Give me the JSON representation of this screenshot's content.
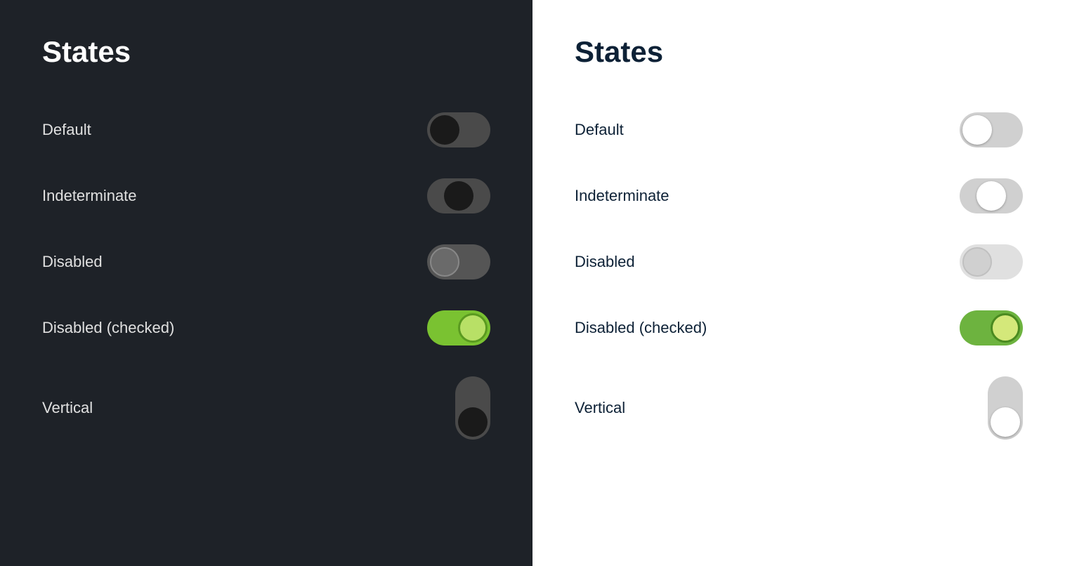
{
  "dark_panel": {
    "title": "States",
    "rows": [
      {
        "id": "default",
        "label": "Default"
      },
      {
        "id": "indeterminate",
        "label": "Indeterminate"
      },
      {
        "id": "disabled",
        "label": "Disabled"
      },
      {
        "id": "disabled-checked",
        "label": "Disabled (checked)"
      },
      {
        "id": "vertical",
        "label": "Vertical"
      }
    ]
  },
  "light_panel": {
    "title": "States",
    "rows": [
      {
        "id": "default",
        "label": "Default"
      },
      {
        "id": "indeterminate",
        "label": "Indeterminate"
      },
      {
        "id": "disabled",
        "label": "Disabled"
      },
      {
        "id": "disabled-checked",
        "label": "Disabled (checked)"
      },
      {
        "id": "vertical",
        "label": "Vertical"
      }
    ]
  }
}
